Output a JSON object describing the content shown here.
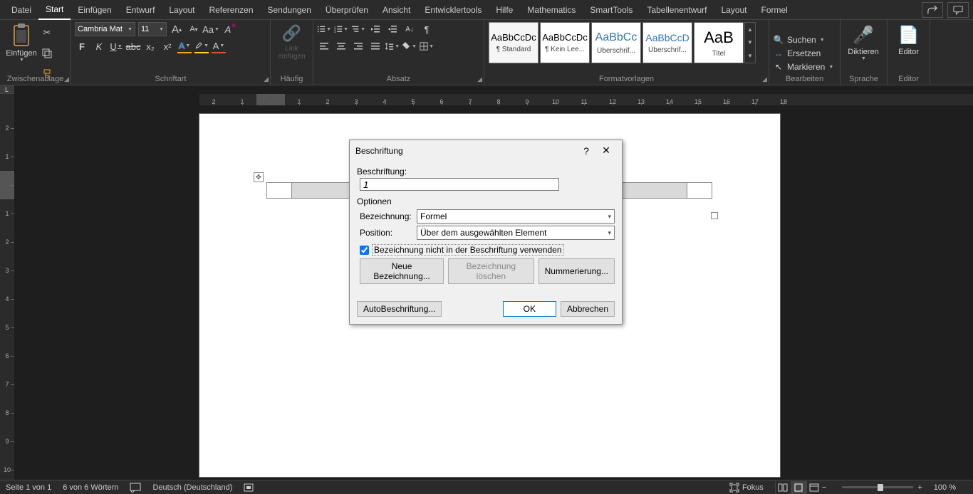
{
  "menubar": {
    "tabs": [
      "Datei",
      "Start",
      "Einfügen",
      "Entwurf",
      "Layout",
      "Referenzen",
      "Sendungen",
      "Überprüfen",
      "Ansicht",
      "Entwicklertools",
      "Hilfe",
      "Mathematics",
      "SmartTools",
      "Tabellenentwurf",
      "Layout",
      "Formel"
    ],
    "active_index": 1
  },
  "ribbon": {
    "clipboard": {
      "paste": "Einfügen",
      "group": "Zwischenablage"
    },
    "font": {
      "name": "Cambria Mat",
      "size": "11",
      "group": "Schriftart",
      "B": "F",
      "I": "K",
      "U": "U",
      "abc": "abc",
      "x2": "x₂",
      "X2": "x²",
      "A": "A",
      "Aa": "Aa",
      "clear": "A✕",
      "grow": "A",
      "shrink": "A"
    },
    "common": {
      "label": "Link einfügen",
      "group": "Häufig"
    },
    "paragraph": {
      "group": "Absatz"
    },
    "styles": {
      "group": "Formatvorlagen",
      "items": [
        {
          "preview": "AaBbCcDc",
          "name": "¶ Standard",
          "blue": false
        },
        {
          "preview": "AaBbCcDc",
          "name": "¶ Kein Lee...",
          "blue": false
        },
        {
          "preview": "AaBbCc",
          "name": "Überschrif...",
          "blue": true
        },
        {
          "preview": "AaBbCcD",
          "name": "Überschrif...",
          "blue": true
        },
        {
          "preview": "AaB",
          "name": "Titel",
          "blue": false
        }
      ]
    },
    "edit": {
      "find": "Suchen",
      "replace": "Ersetzen",
      "select": "Markieren",
      "group": "Bearbeiten"
    },
    "voice": {
      "dictate": "Diktieren",
      "group": "Sprache"
    },
    "editor": {
      "label": "Editor",
      "group": "Editor"
    }
  },
  "ruler": {
    "corner": "L"
  },
  "dialog": {
    "title": "Beschriftung",
    "caption_label": "Beschriftung:",
    "caption_value": "1",
    "options": "Optionen",
    "bez_label": "Bezeichnung:",
    "bez_value": "Formel",
    "pos_label": "Position:",
    "pos_value": "Über dem ausgewählten Element",
    "chk": "Bezeichnung nicht in der Beschriftung verwenden",
    "new_label": "Neue Bezeichnung...",
    "del_label": "Bezeichnung löschen",
    "numbering": "Nummerierung...",
    "auto": "AutoBeschriftung...",
    "ok": "OK",
    "cancel": "Abbrechen"
  },
  "status": {
    "page": "Seite 1 von 1",
    "words": "6 von 6 Wörtern",
    "lang": "Deutsch (Deutschland)",
    "focus": "Fokus",
    "zoom": "100 %"
  }
}
